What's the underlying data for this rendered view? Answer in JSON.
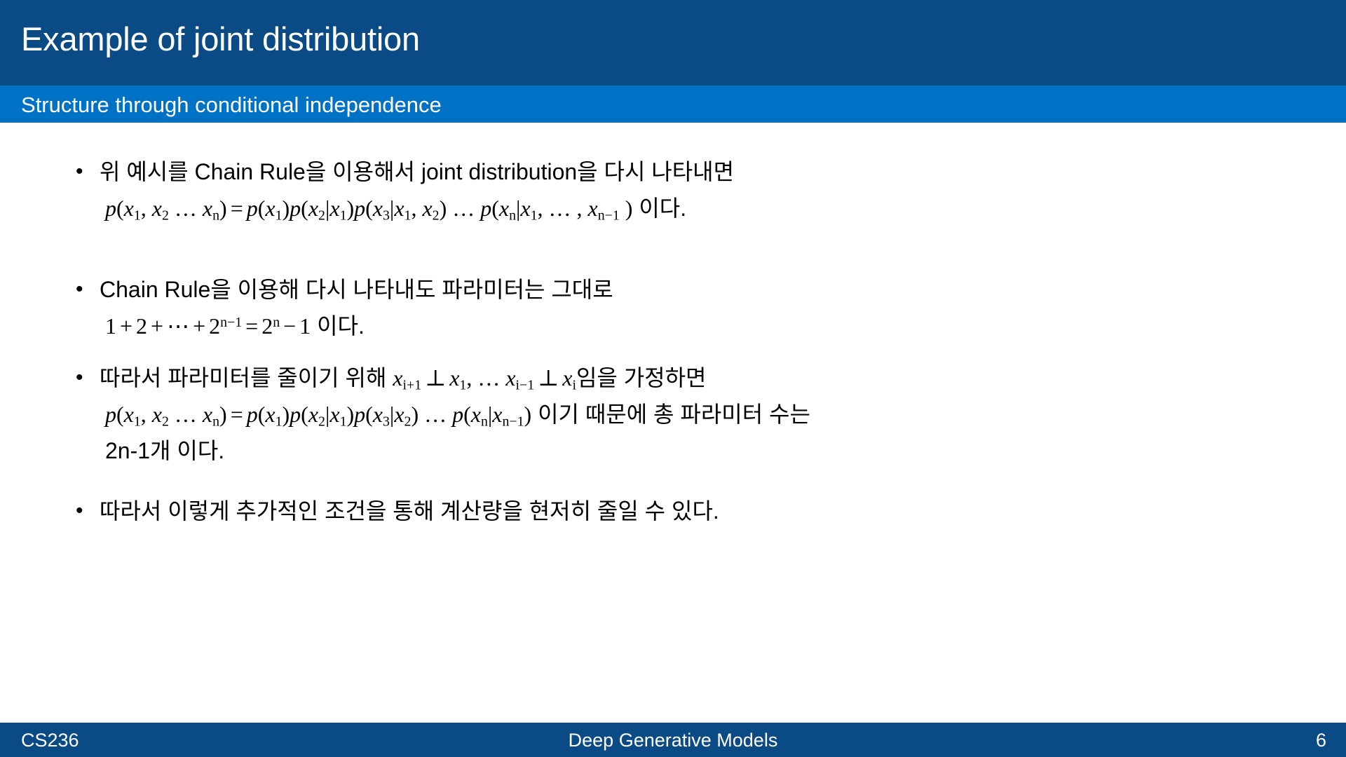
{
  "header": {
    "title": "Example of joint distribution",
    "subtitle": "Structure through conditional independence",
    "title_bg": "#0a4a85",
    "subtitle_bg": "#0072c6",
    "text_color": "#ffffff"
  },
  "bullets": [
    {
      "marker": "•",
      "lines": [
        {
          "kind": "text",
          "text": "위 예시를 Chain Rule을 이용해서 joint distribution을 다시 나타내면"
        },
        {
          "kind": "math",
          "segments": [
            {
              "t": "var",
              "v": "p"
            },
            {
              "t": "op",
              "v": "("
            },
            {
              "t": "var",
              "v": "x",
              "sub": "1"
            },
            {
              "t": "op",
              "v": ", "
            },
            {
              "t": "var",
              "v": "x",
              "sub": "2"
            },
            {
              "t": "op",
              "v": " … "
            },
            {
              "t": "var",
              "v": "x",
              "sub": "n"
            },
            {
              "t": "op",
              "v": ")"
            },
            {
              "t": "rel",
              "v": "="
            },
            {
              "t": "var",
              "v": "p"
            },
            {
              "t": "op",
              "v": "("
            },
            {
              "t": "var",
              "v": "x",
              "sub": "1"
            },
            {
              "t": "op",
              "v": ")"
            },
            {
              "t": "var",
              "v": "p"
            },
            {
              "t": "op",
              "v": "("
            },
            {
              "t": "var",
              "v": "x",
              "sub": "2"
            },
            {
              "t": "op",
              "v": "|"
            },
            {
              "t": "var",
              "v": "x",
              "sub": "1"
            },
            {
              "t": "op",
              "v": ")"
            },
            {
              "t": "var",
              "v": "p"
            },
            {
              "t": "op",
              "v": "("
            },
            {
              "t": "var",
              "v": "x",
              "sub": "3"
            },
            {
              "t": "op",
              "v": "|"
            },
            {
              "t": "var",
              "v": "x",
              "sub": "1"
            },
            {
              "t": "op",
              "v": ", "
            },
            {
              "t": "var",
              "v": "x",
              "sub": "2"
            },
            {
              "t": "op",
              "v": ")"
            },
            {
              "t": "op",
              "v": " … "
            },
            {
              "t": "var",
              "v": "p"
            },
            {
              "t": "op",
              "v": "("
            },
            {
              "t": "var",
              "v": "x",
              "sub": "n"
            },
            {
              "t": "op",
              "v": "|"
            },
            {
              "t": "var",
              "v": "x",
              "sub": "1"
            },
            {
              "t": "op",
              "v": ", … , "
            },
            {
              "t": "var",
              "v": "x",
              "sub": "n−1"
            },
            {
              "t": "op",
              "v": " )"
            },
            {
              "t": "kor",
              "v": " 이다."
            }
          ],
          "plain": "p(x₁, x₂ … xₙ) = p(x₁)p(x₂|x₁)p(x₃|x₁, x₂) … p(xₙ|x₁, … , xₙ₋₁ ) 이다."
        }
      ]
    },
    {
      "marker": "•",
      "lines": [
        {
          "kind": "text",
          "text": "Chain Rule을 이용해 다시 나타내도 파라미터는 그대로"
        },
        {
          "kind": "math",
          "segments": [
            {
              "t": "num",
              "v": "1"
            },
            {
              "t": "rel",
              "v": "+"
            },
            {
              "t": "num",
              "v": "2"
            },
            {
              "t": "rel",
              "v": "+"
            },
            {
              "t": "op",
              "v": "⋯"
            },
            {
              "t": "rel",
              "v": "+"
            },
            {
              "t": "num",
              "v": "2",
              "sup": "n−1"
            },
            {
              "t": "rel",
              "v": "="
            },
            {
              "t": "num",
              "v": "2",
              "sup": "n"
            },
            {
              "t": "rel",
              "v": "−"
            },
            {
              "t": "num",
              "v": "1"
            },
            {
              "t": "kor",
              "v": " 이다."
            }
          ],
          "plain": "1 + 2 + ⋯ + 2ⁿ⁻¹ = 2ⁿ − 1 이다."
        }
      ]
    },
    {
      "marker": "•",
      "lines": [
        {
          "kind": "mixed",
          "segments": [
            {
              "t": "kor",
              "v": "따라서 파라미터를 줄이기 위해 "
            },
            {
              "t": "var",
              "v": "x",
              "sub": "i+1"
            },
            {
              "t": "rel",
              "v": "⊥"
            },
            {
              "t": "var",
              "v": "x",
              "sub": "1"
            },
            {
              "t": "op",
              "v": ", … "
            },
            {
              "t": "var",
              "v": "x",
              "sub": "i−1"
            },
            {
              "t": "rel",
              "v": "⊥"
            },
            {
              "t": "var",
              "v": "x",
              "sub": "i"
            },
            {
              "t": "kor",
              "v": "임을 가정하면"
            }
          ],
          "plain": "따라서 파라미터를 줄이기 위해 xᵢ₊₁ ⊥ x₁, … xᵢ₋₁ ⊥ xᵢ 임을 가정하면"
        },
        {
          "kind": "math",
          "segments": [
            {
              "t": "var",
              "v": "p"
            },
            {
              "t": "op",
              "v": "("
            },
            {
              "t": "var",
              "v": "x",
              "sub": "1"
            },
            {
              "t": "op",
              "v": ", "
            },
            {
              "t": "var",
              "v": "x",
              "sub": "2"
            },
            {
              "t": "op",
              "v": " … "
            },
            {
              "t": "var",
              "v": "x",
              "sub": "n"
            },
            {
              "t": "op",
              "v": ")"
            },
            {
              "t": "rel",
              "v": "="
            },
            {
              "t": "var",
              "v": "p"
            },
            {
              "t": "op",
              "v": "("
            },
            {
              "t": "var",
              "v": "x",
              "sub": "1"
            },
            {
              "t": "op",
              "v": ")"
            },
            {
              "t": "var",
              "v": "p"
            },
            {
              "t": "op",
              "v": "("
            },
            {
              "t": "var",
              "v": "x",
              "sub": "2"
            },
            {
              "t": "op",
              "v": "|"
            },
            {
              "t": "var",
              "v": "x",
              "sub": "1"
            },
            {
              "t": "op",
              "v": ")"
            },
            {
              "t": "var",
              "v": "p"
            },
            {
              "t": "op",
              "v": "("
            },
            {
              "t": "var",
              "v": "x",
              "sub": "3"
            },
            {
              "t": "op",
              "v": "|"
            },
            {
              "t": "var",
              "v": "x",
              "sub": "2"
            },
            {
              "t": "op",
              "v": ")"
            },
            {
              "t": "op",
              "v": " … "
            },
            {
              "t": "var",
              "v": "p"
            },
            {
              "t": "op",
              "v": "("
            },
            {
              "t": "var",
              "v": "x",
              "sub": "n"
            },
            {
              "t": "op",
              "v": "|"
            },
            {
              "t": "var",
              "v": "x",
              "sub": "n−1"
            },
            {
              "t": "op",
              "v": ")"
            },
            {
              "t": "kor",
              "v": " 이기 때문에 총 파라미터 수는"
            }
          ],
          "plain": "p(x₁, x₂ … xₙ) = p(x₁)p(x₂|x₁)p(x₃|x₂) … p(xₙ|xₙ₋₁) 이기 때문에 총 파라미터 수는"
        },
        {
          "kind": "text",
          "text": "2n-1개 이다."
        }
      ]
    },
    {
      "marker": "•",
      "lines": [
        {
          "kind": "text",
          "text": "따라서 이렇게 추가적인 조건을 통해 계산량을 현저히 줄일 수 있다."
        }
      ]
    }
  ],
  "footer": {
    "course": "CS236",
    "center": "Deep Generative Models",
    "page_number": "6",
    "page_number_ghost": "6",
    "bg": "#0a4a85",
    "text_color": "#ffffff",
    "ghost_color": "#b4b4b4"
  }
}
